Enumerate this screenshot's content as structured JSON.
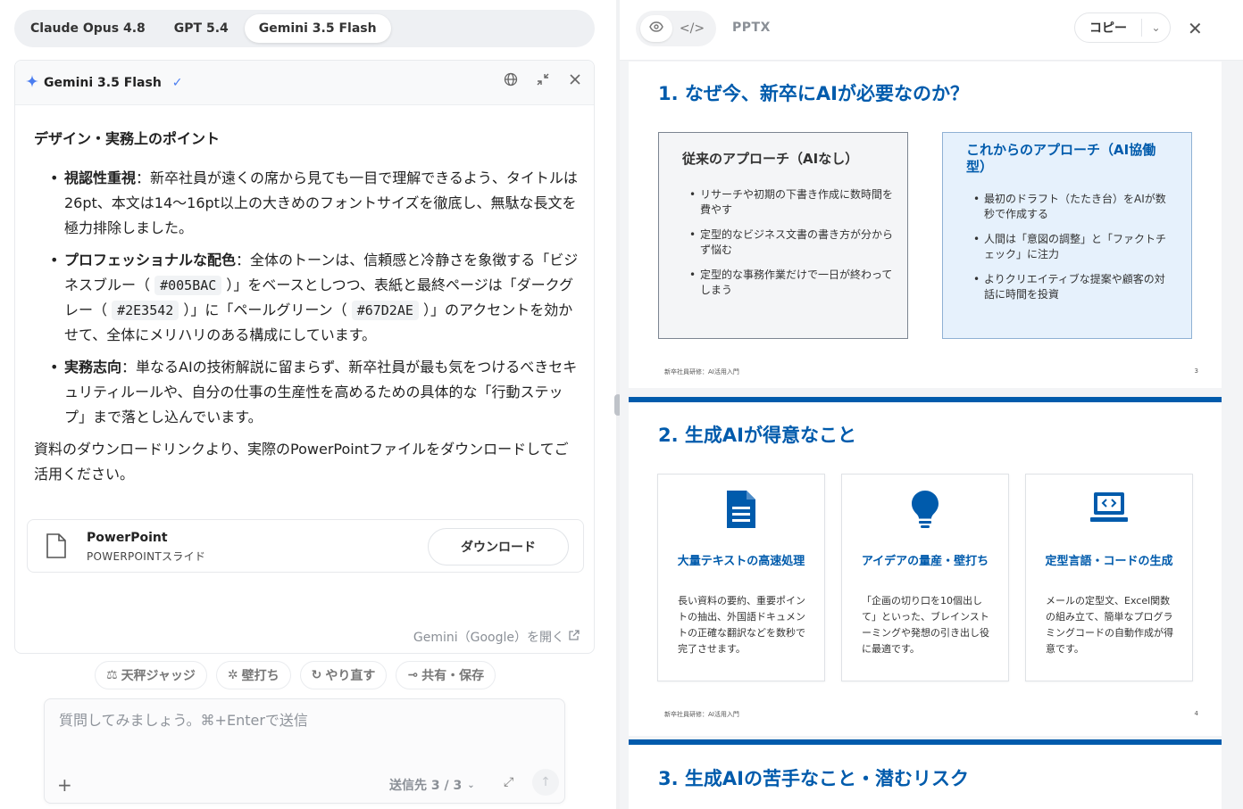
{
  "model_tabs": [
    "Claude Opus 4.8",
    "GPT 5.4",
    "Gemini 3.5 Flash"
  ],
  "card": {
    "title": "Gemini 3.5 Flash",
    "heading": "デザイン・実務上のポイント",
    "bullet1_bold": "視認性重視",
    "bullet1_text": "：新卒社員が遠くの席から見ても一目で理解できるよう、タイトルは26pt、本文は14〜16pt以上の大きめのフォントサイズを徹底し、無駄な長文を極力排除しました。",
    "bullet2_bold": "プロフェッショナルな配色",
    "bullet2_a": "：全体のトーンは、信頼感と冷静さを象徴する「ビジネスブルー（ ",
    "bullet2_code1": "#005BAC",
    "bullet2_b": " ）」をベースとしつつ、表紙と最終ページは「ダークグレー（ ",
    "bullet2_code2": "#2E3542",
    "bullet2_c": " ）」に「ペールグリーン（ ",
    "bullet2_code3": "#67D2AE",
    "bullet2_d": " ）」のアクセントを効かせて、全体にメリハリのある構成にしています。",
    "bullet3_bold": "実務志向",
    "bullet3_text": "：単なるAIの技術解説に留まらず、新卒社員が最も気をつけるべきセキュリティルールや、自分の仕事の生産性を高めるための具体的な「行動ステップ」まで落とし込んでいます。",
    "closing": "資料のダウンロードリンクより、実際のPowerPointファイルをダウンロードしてご活用ください。",
    "file_name": "PowerPoint",
    "file_type": "POWERPOINTスライド",
    "download_label": "ダウンロード",
    "open_link": "Gemini（Google）を開く"
  },
  "actions": [
    "天秤ジャッジ",
    "壁打ち",
    "やり直す",
    "共有・保存"
  ],
  "input": {
    "placeholder": "質問してみましょう。⌘+Enterで送信",
    "send_target": "送信先 3 / 3"
  },
  "preview": {
    "format": "PPTX",
    "copy_label": "コピー"
  },
  "slides": {
    "s3": {
      "title": "1. なぜ今、新卒にAIが必要なのか？",
      "left_title": "従来のアプローチ（AIなし）",
      "left_items": [
        "リサーチや初期の下書き作成に数時間を費やす",
        "定型的なビジネス文書の書き方が分からず悩む",
        "定型的な事務作業だけで一日が終わってしまう"
      ],
      "right_title": "これからのアプローチ（AI協働型）",
      "right_items": [
        "最初のドラフト（たたき台）をAIが数秒で作成する",
        "人間は「意図の調整」と「ファクトチェック」に注力",
        "よりクリエイティブな提案や顧客の対話に時間を投資"
      ],
      "footer": "新卒社員研修：AI活用入門",
      "page": "3"
    },
    "s4": {
      "title": "2. 生成AIが得意なこと",
      "cards": [
        {
          "name": "大量テキストの高速処理",
          "desc": "長い資料の要約、重要ポイントの抽出、外国語ドキュメントの正確な翻訳などを数秒で完了させます。"
        },
        {
          "name": "アイデアの量産・壁打ち",
          "desc": "「企画の切り口を10個出して」といった、ブレインストーミングや発想の引き出し役に最適です。"
        },
        {
          "name": "定型言語・コードの生成",
          "desc": "メールの定型文、Excel関数の組み立て、簡単なプログラミングコードの自動作成が得意です。"
        }
      ],
      "footer": "新卒社員研修：AI活用入門",
      "page": "4"
    },
    "s5": {
      "title": "3. 生成AIの苦手なこと・潜むリスク"
    }
  },
  "colors": {
    "brand_blue": "#005BAC",
    "box_gray": "#f4f5f7",
    "box_blue": "#e6f1fc"
  },
  "icons": [
    "sparkle-icon",
    "verified-check-icon",
    "globe-icon",
    "collapse-icon",
    "close-icon",
    "file-icon",
    "external-link-icon",
    "scale-icon",
    "brainstorm-icon",
    "refresh-icon",
    "link-icon",
    "plus-icon",
    "chevron-down-icon",
    "expand-icon",
    "send-arrow-icon",
    "eye-icon",
    "code-icon",
    "document-icon",
    "lightbulb-icon",
    "laptop-code-icon"
  ]
}
